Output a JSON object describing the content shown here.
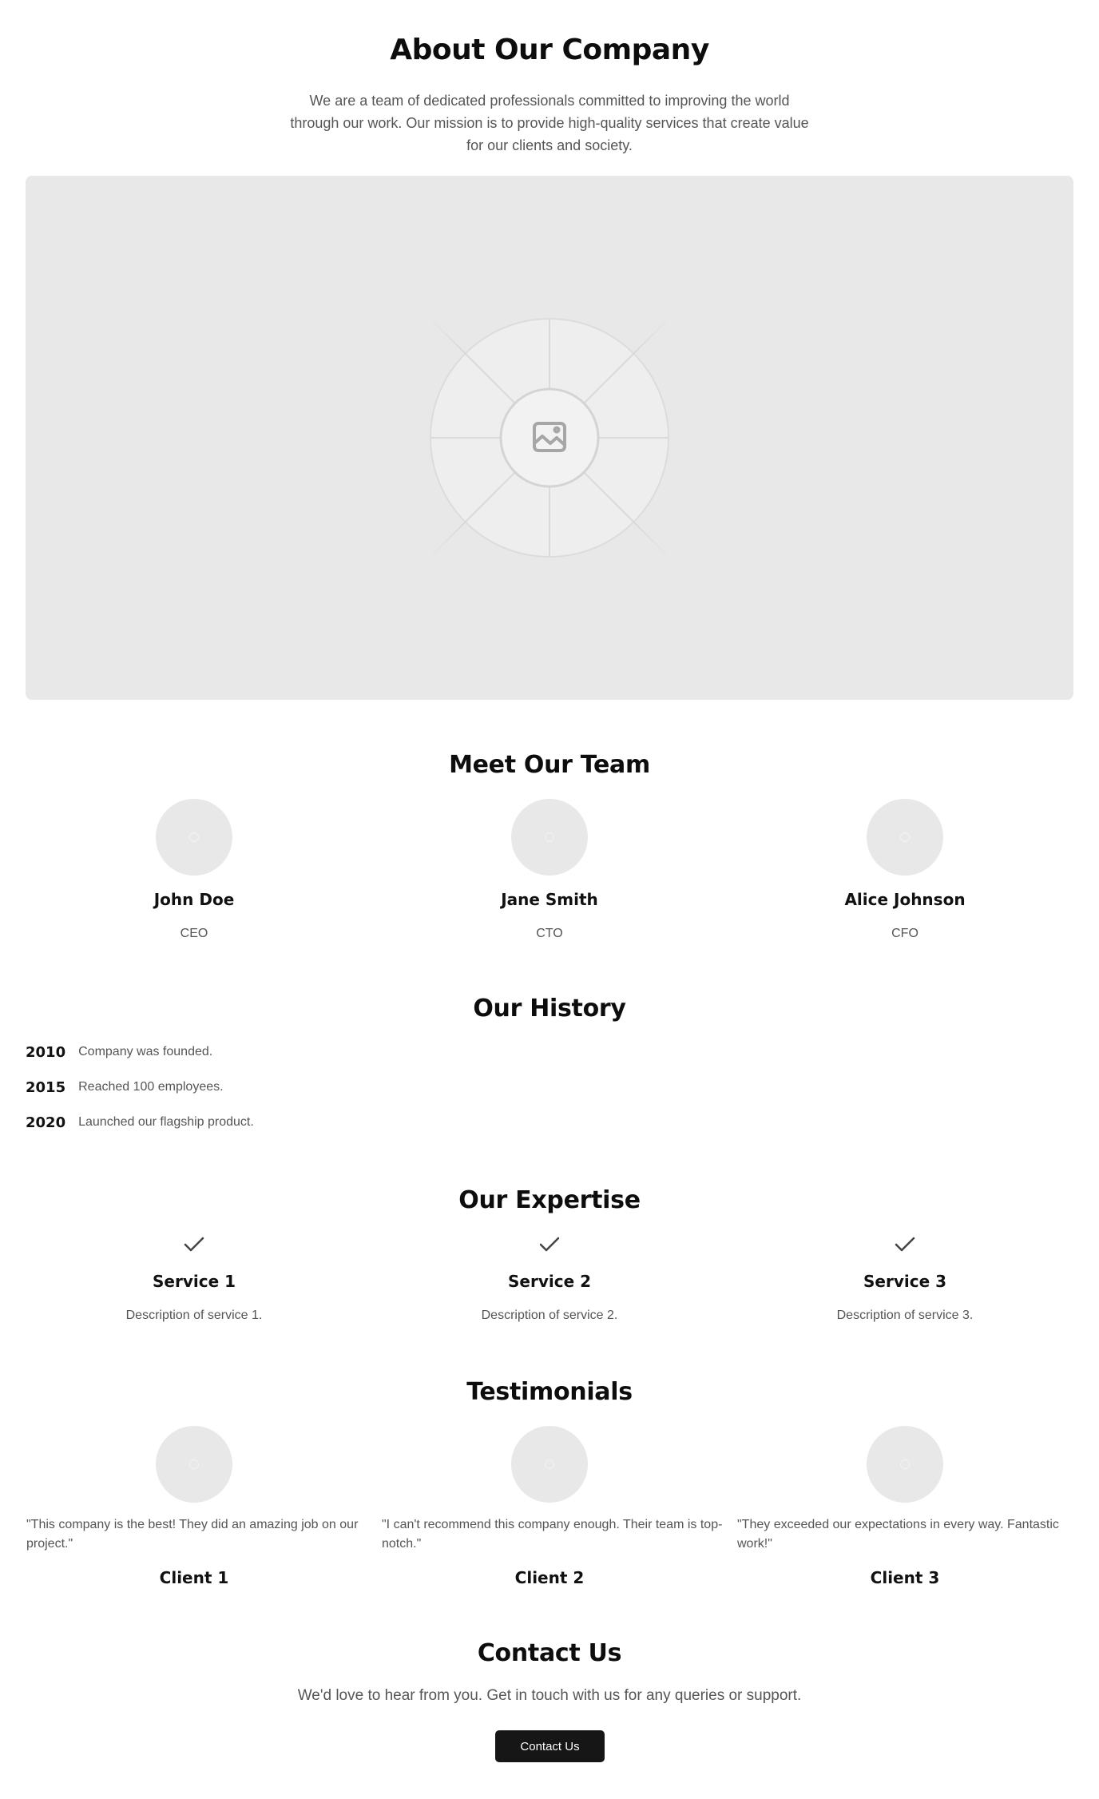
{
  "about": {
    "title": "About Our Company",
    "text": "We are a team of dedicated professionals committed to improving the world through our work. Our mission is to provide high-quality services that create value for our clients and society.",
    "image_icon": "image-placeholder-icon"
  },
  "team": {
    "title": "Meet Our Team",
    "members": [
      {
        "name": "John Doe",
        "role": "CEO"
      },
      {
        "name": "Jane Smith",
        "role": "CTO"
      },
      {
        "name": "Alice Johnson",
        "role": "CFO"
      }
    ]
  },
  "history": {
    "title": "Our History",
    "events": [
      {
        "year": "2010",
        "text": "Company was founded."
      },
      {
        "year": "2015",
        "text": "Reached 100 employees."
      },
      {
        "year": "2020",
        "text": "Launched our flagship product."
      }
    ]
  },
  "expertise": {
    "title": "Our Expertise",
    "icon": "check-icon",
    "services": [
      {
        "name": "Service 1",
        "description": "Description of service 1."
      },
      {
        "name": "Service 2",
        "description": "Description of service 2."
      },
      {
        "name": "Service 3",
        "description": "Description of service 3."
      }
    ]
  },
  "testimonials": {
    "title": "Testimonials",
    "items": [
      {
        "quote": "\"This company is the best! They did an amazing job on our project.\"",
        "client": "Client 1"
      },
      {
        "quote": "\"I can't recommend this company enough. Their team is top-notch.\"",
        "client": "Client 2"
      },
      {
        "quote": "\"They exceeded our expectations in every way. Fantastic work!\"",
        "client": "Client 3"
      }
    ]
  },
  "contact": {
    "title": "Contact Us",
    "text": "We'd love to hear from you. Get in touch with us for any queries or support.",
    "button_label": "Contact Us"
  },
  "colors": {
    "background": "#ffffff",
    "placeholder": "#e8e8e8",
    "muted_text": "#555555",
    "button": "#161616"
  }
}
